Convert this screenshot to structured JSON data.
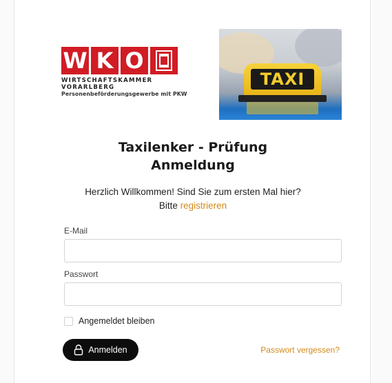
{
  "brand": {
    "logo_letters": [
      "W",
      "K",
      "O"
    ],
    "logo_line1": "WIRTSCHAFTSKAMMER VORARLBERG",
    "logo_line2": "Personenbeförderungsgewerbe mit PKW",
    "photo_sign_text": "TAXI",
    "brand_color": "#d11c25"
  },
  "heading": {
    "line1": "Taxilenker - Prüfung",
    "line2": "Anmeldung"
  },
  "welcome": {
    "text": "Herzlich Willkommen! Sind Sie zum ersten Mal hier?",
    "prefix": "Bitte",
    "register_link": "registrieren",
    "link_color": "#d28a1a"
  },
  "form": {
    "email_label": "E-Mail",
    "email_value": "",
    "password_label": "Passwort",
    "password_value": "",
    "remember_label": "Angemeldet bleiben",
    "remember_checked": false,
    "login_button": "Anmelden",
    "login_icon": "lock-icon",
    "forgot_link": "Passwort vergessen?"
  }
}
